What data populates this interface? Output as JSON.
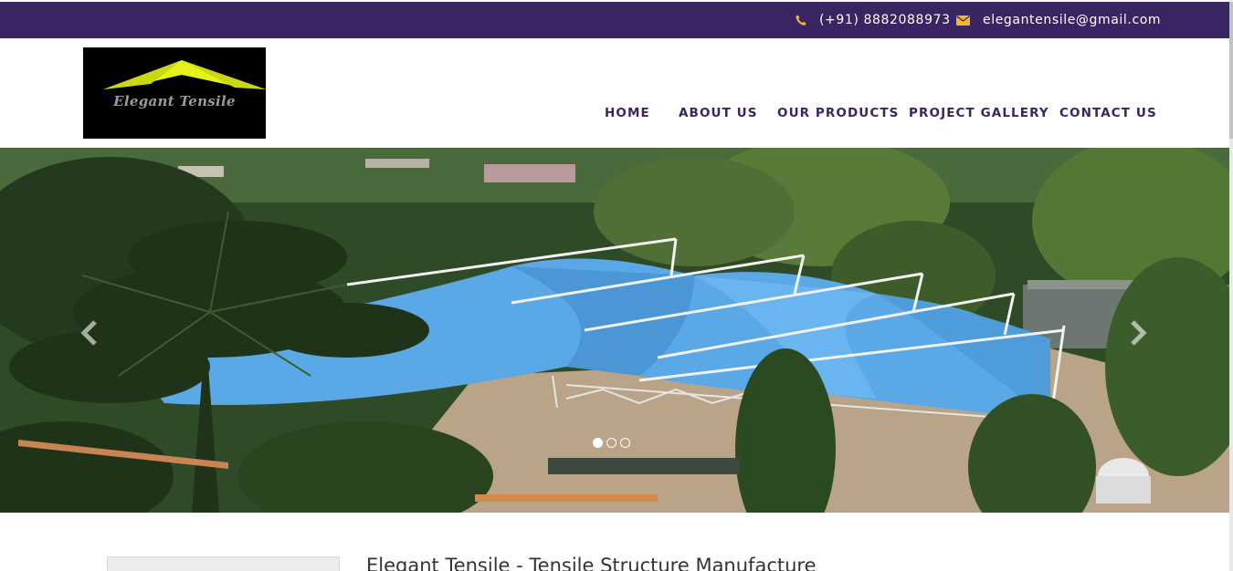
{
  "topbar": {
    "phone": "(+91) 8882088973",
    "email": "elegantensile@gmail.com",
    "phone_icon": "phone-icon",
    "email_icon": "envelope-icon"
  },
  "header": {
    "logo_text": "Elegant Tensile"
  },
  "nav": {
    "items": [
      {
        "label": "HOME"
      },
      {
        "label": "ABOUT US"
      },
      {
        "label": "OUR PRODUCTS"
      },
      {
        "label": "PROJECT GALLERY"
      },
      {
        "label": "CONTACT US"
      }
    ]
  },
  "slider": {
    "prev_icon": "chevron-left-icon",
    "next_icon": "chevron-right-icon",
    "slide_count": 3,
    "active_slide": 1
  },
  "content": {
    "title": "Elegant Tensile - Tensile Structure Manufacture"
  },
  "colors": {
    "brand": "#3a2562",
    "accent_icon": "#f2b632",
    "logo_yellow": "#e4f21a",
    "canopy_blue": "#5aa8e6"
  }
}
